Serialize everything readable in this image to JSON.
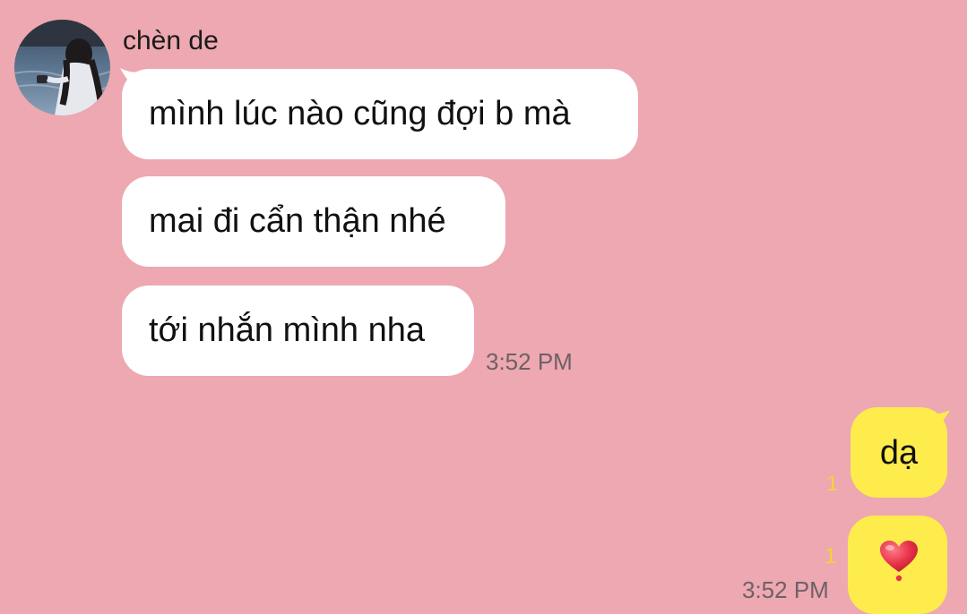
{
  "chat": {
    "contact": {
      "name": "chèn de",
      "avatar_icon": "profile-photo"
    },
    "incoming": {
      "messages": [
        {
          "text": "mình lúc nào cũng đợi b mà"
        },
        {
          "text": "mai đi cẩn thận nhé"
        },
        {
          "text": "tới nhắn mình nha"
        }
      ],
      "timestamp": "3:52 PM"
    },
    "outgoing": {
      "messages": [
        {
          "text": "dạ",
          "unread_count": "1"
        },
        {
          "emoji": "heart-icon",
          "unread_count": "1"
        }
      ],
      "timestamp": "3:52 PM"
    }
  },
  "colors": {
    "background": "#EDA8B1",
    "incoming_bubble": "#FFFFFF",
    "outgoing_bubble": "#FEEC4C",
    "unread_badge": "#F2D33A",
    "timestamp": "#6E6166",
    "heart": "#E8334A"
  }
}
